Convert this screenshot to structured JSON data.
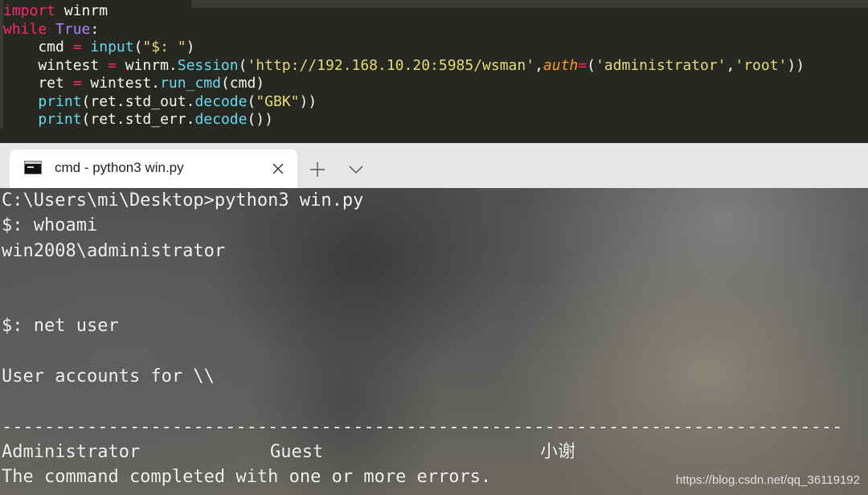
{
  "editor": {
    "lines": [
      [
        {
          "t": "kw",
          "s": "import"
        },
        {
          "t": "id",
          "s": " winrm"
        }
      ],
      [
        {
          "t": "kw",
          "s": "while"
        },
        {
          "t": "id",
          "s": " "
        },
        {
          "t": "const",
          "s": "True"
        },
        {
          "t": "id",
          "s": ":"
        }
      ],
      [
        {
          "t": "id",
          "s": "    cmd "
        },
        {
          "t": "kw",
          "s": "="
        },
        {
          "t": "id",
          "s": " "
        },
        {
          "t": "fn",
          "s": "input"
        },
        {
          "t": "id",
          "s": "("
        },
        {
          "t": "str",
          "s": "\"$: \""
        },
        {
          "t": "id",
          "s": ")"
        }
      ],
      [
        {
          "t": "id",
          "s": "    wintest "
        },
        {
          "t": "kw",
          "s": "="
        },
        {
          "t": "id",
          "s": " winrm."
        },
        {
          "t": "fn",
          "s": "Session"
        },
        {
          "t": "id",
          "s": "("
        },
        {
          "t": "str",
          "s": "'http://192.168.10.20:5985/wsman'"
        },
        {
          "t": "id",
          "s": ","
        },
        {
          "t": "arg",
          "s": "auth"
        },
        {
          "t": "kw",
          "s": "="
        },
        {
          "t": "id",
          "s": "("
        },
        {
          "t": "str",
          "s": "'administrator'"
        },
        {
          "t": "id",
          "s": ","
        },
        {
          "t": "str",
          "s": "'root'"
        },
        {
          "t": "id",
          "s": "))"
        }
      ],
      [
        {
          "t": "id",
          "s": "    ret "
        },
        {
          "t": "kw",
          "s": "="
        },
        {
          "t": "id",
          "s": " wintest."
        },
        {
          "t": "fn",
          "s": "run_cmd"
        },
        {
          "t": "id",
          "s": "(cmd)"
        }
      ],
      [
        {
          "t": "id",
          "s": "    "
        },
        {
          "t": "fn",
          "s": "print"
        },
        {
          "t": "id",
          "s": "(ret.std_out."
        },
        {
          "t": "fn",
          "s": "decode"
        },
        {
          "t": "id",
          "s": "("
        },
        {
          "t": "str",
          "s": "\"GBK\""
        },
        {
          "t": "id",
          "s": "))"
        }
      ],
      [
        {
          "t": "id",
          "s": "    "
        },
        {
          "t": "fn",
          "s": "print"
        },
        {
          "t": "id",
          "s": "(ret.std_err."
        },
        {
          "t": "fn",
          "s": "decode"
        },
        {
          "t": "id",
          "s": "())"
        }
      ]
    ]
  },
  "terminal": {
    "tab_title": "cmd - python3  win.py",
    "tab_icon": "console-icon",
    "close_icon": "close-icon",
    "new_tab_icon": "plus-icon",
    "dropdown_icon": "chevron-down-icon",
    "lines": [
      "C:\\Users\\mi\\Desktop>python3 win.py",
      "$: whoami",
      "win2008\\administrator",
      "",
      "",
      "$: net user",
      "",
      "User accounts for \\\\",
      "",
      "-------------------------------------------------------------------------------"
    ],
    "accounts": [
      "Administrator",
      "Guest",
      "小谢"
    ],
    "completion": "The command completed with one or more errors."
  },
  "watermark": "https://blog.csdn.net/qq_36119192"
}
